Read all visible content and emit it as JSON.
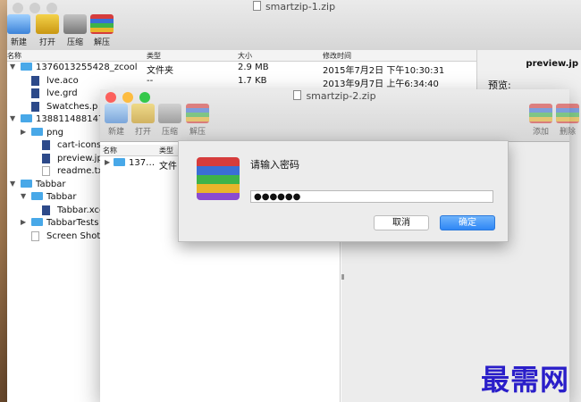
{
  "back": {
    "title": "smartzip-1.zip",
    "toolbar": [
      "新建",
      "打开",
      "压缩",
      "解压"
    ],
    "columns": [
      "名称",
      "类型",
      "大小",
      "修改时间"
    ],
    "rows": [
      {
        "name": "1376013255428_zcool",
        "type": "文件夹",
        "size": "2.9 MB",
        "date": "2015年7月2日 下午10:30:31",
        "kind": "folder",
        "indent": 0,
        "expanded": true
      },
      {
        "name": "lve.aco",
        "type": "--",
        "size": "1.7 KB",
        "date": "2013年9月7日 上午6:34:40",
        "kind": "file",
        "indent": 1
      },
      {
        "name": "lve.grd",
        "type": "",
        "size": "",
        "date": "",
        "kind": "file",
        "indent": 1
      },
      {
        "name": "Swatches.p",
        "type": "",
        "size": "",
        "date": "",
        "kind": "file",
        "indent": 1
      },
      {
        "name": "1388114881475",
        "type": "",
        "size": "",
        "date": "",
        "kind": "folder",
        "indent": 0,
        "expanded": true
      },
      {
        "name": "png",
        "type": "",
        "size": "",
        "date": "",
        "kind": "folder",
        "indent": 1,
        "expanded": false
      },
      {
        "name": "cart-icons.",
        "type": "",
        "size": "",
        "date": "",
        "kind": "file",
        "indent": 2
      },
      {
        "name": "preview.jpg",
        "type": "",
        "size": "",
        "date": "",
        "kind": "file",
        "indent": 2
      },
      {
        "name": "readme.txt",
        "type": "",
        "size": "",
        "date": "",
        "kind": "txt",
        "indent": 2
      },
      {
        "name": "Tabbar",
        "type": "",
        "size": "",
        "date": "",
        "kind": "folder",
        "indent": 0,
        "expanded": true
      },
      {
        "name": "Tabbar",
        "type": "",
        "size": "",
        "date": "",
        "kind": "folder",
        "indent": 1,
        "expanded": true
      },
      {
        "name": "Tabbar.xco",
        "type": "",
        "size": "",
        "date": "",
        "kind": "file",
        "indent": 2
      },
      {
        "name": "TabbarTests",
        "type": "",
        "size": "",
        "date": "",
        "kind": "folder",
        "indent": 1,
        "expanded": false
      },
      {
        "name": "Screen Shot 2",
        "type": "",
        "size": "",
        "date": "",
        "kind": "txt",
        "indent": 1
      }
    ],
    "side": {
      "preview_file": "preview.jp",
      "preview_label": "预览:"
    }
  },
  "front": {
    "title": "smartzip-2.zip",
    "toolbar": [
      "新建",
      "打开",
      "压缩",
      "解压"
    ],
    "toolbar_right": [
      "添加",
      "删除"
    ],
    "columns": [
      "名称",
      "类型"
    ],
    "row": {
      "name": "137…",
      "type": "文件"
    }
  },
  "dialog": {
    "prompt": "请输入密码",
    "password": "●●●●●●",
    "cancel": "取消",
    "ok": "确定"
  },
  "watermark": "最需网",
  "colors": {
    "ok_button": "#2f86f5",
    "folder": "#48a8e8",
    "watermark": "#2a1ec9"
  }
}
